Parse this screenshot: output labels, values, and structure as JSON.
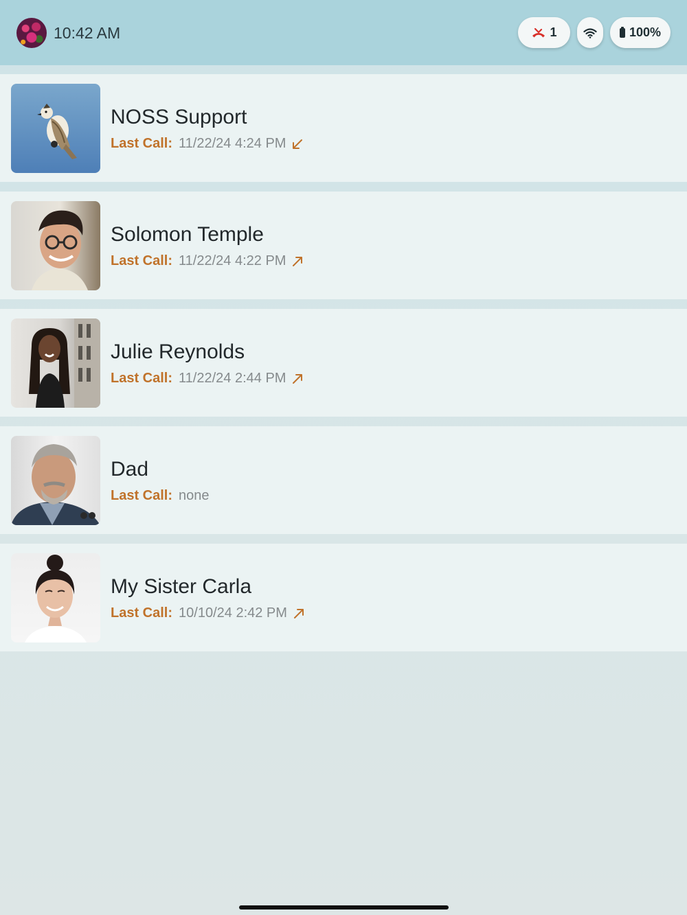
{
  "status_bar": {
    "time": "10:42 AM",
    "missed_calls_count": "1",
    "battery_text": "100%",
    "user_avatar_icon": "flower-avatar",
    "missed_call_icon": "missed-call-icon",
    "wifi_icon": "wifi-icon",
    "battery_icon": "battery-icon"
  },
  "colors": {
    "header_bg": "#aad3dc",
    "row_bg": "#ebf3f3",
    "accent_label": "#c0722a",
    "missed_red": "#d8302a"
  },
  "contacts": [
    {
      "name": "NOSS Support",
      "last_call_label": "Last Call:",
      "last_call": "11/22/24  4:24 PM",
      "direction": "incoming",
      "photo": "bird-logo"
    },
    {
      "name": "Solomon Temple",
      "last_call_label": "Last Call:",
      "last_call": "11/22/24  4:22 PM",
      "direction": "outgoing",
      "photo": "man-glasses-photo"
    },
    {
      "name": "Julie Reynolds",
      "last_call_label": "Last Call:",
      "last_call": "11/22/24  2:44 PM",
      "direction": "outgoing",
      "photo": "woman-braids-photo"
    },
    {
      "name": "Dad",
      "last_call_label": "Last Call:",
      "last_call": "none",
      "direction": "none",
      "photo": "older-man-photo"
    },
    {
      "name": "My Sister Carla",
      "last_call_label": "Last Call:",
      "last_call": "10/10/24  2:42 PM",
      "direction": "outgoing",
      "photo": "woman-bun-photo"
    }
  ]
}
